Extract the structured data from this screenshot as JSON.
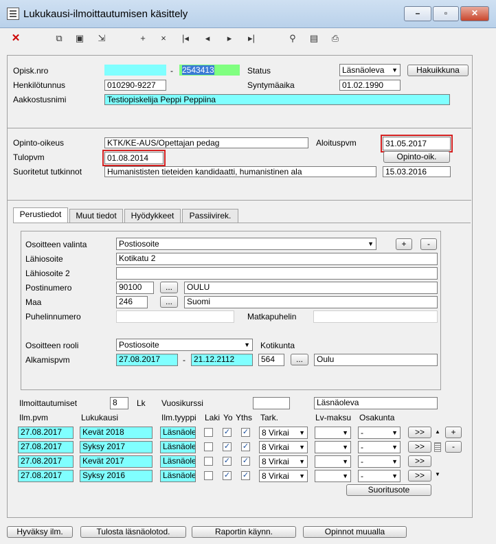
{
  "window": {
    "title": "Lukukausi-ilmoittautumisen käsittely",
    "minimize": "–",
    "maximize": "▫",
    "close": "✕"
  },
  "toolbar": {
    "delete": "✕",
    "copy": "⧉",
    "save": "▣",
    "export": "⇲",
    "b1": "+",
    "b2": "×",
    "b3": "|◂",
    "b4": "◂",
    "b5": "▸",
    "b6": "▸|",
    "search": "⚲",
    "doc": "▤",
    "print": "⎙"
  },
  "student": {
    "opisk_nro_label": "Opisk.nro",
    "opisk_nro_dash": "-",
    "opisk_nro": "2543413",
    "status_label": "Status",
    "status": "Läsnäoleva",
    "hakuikkuna": "Hakuikkuna",
    "hetu_label": "Henkilötunnus",
    "hetu": "010290-9227",
    "syntymaaika_label": "Syntymäaika",
    "syntymaaika": "01.02.1990",
    "aakkostusnimi_label": "Aakkostusnimi",
    "aakkostusnimi": "Testiopiskelija Peppi Peppiina"
  },
  "right": {
    "opinto_oikeus_label": "Opinto-oikeus",
    "opinto_oikeus": "KTK/KE-AUS/Opettajan pedag",
    "aloituspvm_label": "Aloituspvm",
    "aloituspvm": "31.05.2017",
    "tulopvm_label": "Tulopvm",
    "tulopvm": "01.08.2014",
    "opinto_oik_button": "Opinto-oik.",
    "suoritetut_label": "Suoritetut tutkinnot",
    "suoritetut": "Humanististen tieteiden kandidaatti, humanistinen ala",
    "suoritetut_pvm": "15.03.2016"
  },
  "tabs": [
    "Perustiedot",
    "Muut tiedot",
    "Hyödykkeet",
    "Passiivirek."
  ],
  "address": {
    "valinta_label": "Osoitteen valinta",
    "valinta": "Postiosoite",
    "plus": "+",
    "minus": "-",
    "lahiosoite_label": "Lähiosoite",
    "lahiosoite": "Kotikatu 2",
    "lahiosoite2_label": "Lähiosoite 2",
    "lahiosoite2": "",
    "postinumero_label": "Postinumero",
    "postinumero": "90100",
    "ellipsis": "...",
    "postitoimipaikka": "OULU",
    "maa_label": "Maa",
    "maa_koodi": "246",
    "maa": "Suomi",
    "puhelin_label": "Puhelinnumero",
    "puhelin": "",
    "matkapuhelin_label": "Matkapuhelin",
    "matkapuhelin": "",
    "rooli_label": "Osoitteen rooli",
    "rooli": "Postiosoite",
    "kotikunta_label": "Kotikunta",
    "alkamispvm_label": "Alkamispvm",
    "alkamispvm": "27.08.2017",
    "dash": "-",
    "loppupvm": "21.12.2112",
    "kotikunta_koodi": "564",
    "kotikunta": "Oulu"
  },
  "registration": {
    "ilmoittautumiset_label": "Ilmoittautumiset",
    "count": "8",
    "lk": "Lk",
    "vuosikurssi_label": "Vuosikurssi",
    "vuosikurssi": "",
    "status": "Läsnäoleva",
    "headers": {
      "ilm_pvm": "Ilm.pvm",
      "lukukausi": "Lukukausi",
      "ilm_tyyppi": "Ilm.tyyppi",
      "laki": "Laki",
      "yo": "Yo",
      "yths": "Yths",
      "tark": "Tark.",
      "lv_maksu": "Lv-maksu",
      "osakunta": "Osakunta"
    },
    "rows": [
      {
        "date": "27.08.2017",
        "term": "Kevät 2018",
        "type": "Läsnäole",
        "tark": "8 Virkai",
        "lv": "",
        "osakunta": "-",
        "go": ">>"
      },
      {
        "date": "27.08.2017",
        "term": "Syksy 2017",
        "type": "Läsnäole",
        "tark": "8 Virkai",
        "lv": "",
        "osakunta": "-",
        "go": ">>"
      },
      {
        "date": "27.08.2017",
        "term": "Kevät 2017",
        "type": "Läsnäole",
        "tark": "8 Virkai",
        "lv": "",
        "osakunta": "-",
        "go": ">>"
      },
      {
        "date": "27.08.2017",
        "term": "Syksy 2016",
        "type": "Läsnäole",
        "tark": "8 Virkai",
        "lv": "",
        "osakunta": "-",
        "go": ">>"
      }
    ],
    "row_plus": "+",
    "row_minus": "-",
    "suoritusote": "Suoritusote"
  },
  "footer": {
    "hyvaksy": "Hyväksy ilm.",
    "tulosta": "Tulosta läsnäolotod.",
    "raportin": "Raportin käynn.",
    "opinnot": "Opinnot muualla"
  }
}
